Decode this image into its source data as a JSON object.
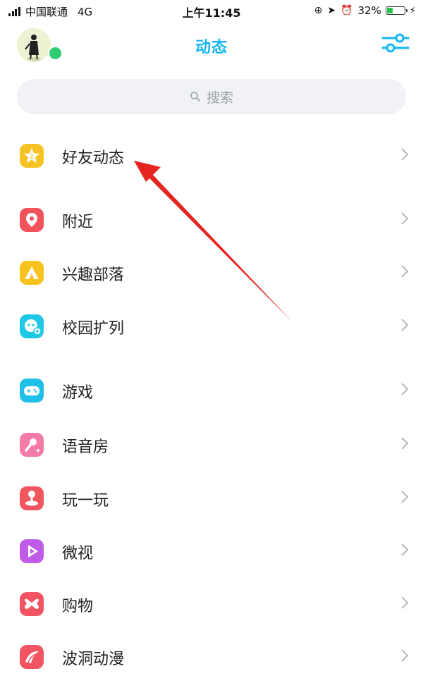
{
  "status_bar": {
    "carrier": "中国联通",
    "network": "4G",
    "time": "上午11:45",
    "battery_pct": "32%",
    "battery_level": 0.32
  },
  "header": {
    "title": "动态",
    "avatar_icon": "avatar-icon",
    "settings_icon": "sliders-icon"
  },
  "search": {
    "placeholder": "搜索"
  },
  "menu": [
    {
      "label": "好友动态",
      "icon": "star-icon",
      "color": "#f7c324"
    },
    {
      "label": "附近",
      "icon": "location-pin-icon",
      "color": "#f0535a"
    },
    {
      "label": "兴趣部落",
      "icon": "triangle-tribe-icon",
      "color": "#f6c21b"
    },
    {
      "label": "校园扩列",
      "icon": "campus-chat-icon",
      "color": "#1ec8e6"
    },
    {
      "label": "游戏",
      "icon": "gamepad-icon",
      "color": "#1ec0ea"
    },
    {
      "label": "语音房",
      "icon": "microphone-icon",
      "color": "#f47aa7"
    },
    {
      "label": "玩一玩",
      "icon": "joystick-icon",
      "color": "#f0565d"
    },
    {
      "label": "微视",
      "icon": "play-icon",
      "color": "#c05ae8"
    },
    {
      "label": "购物",
      "icon": "shopping-icon",
      "color": "#f25561"
    },
    {
      "label": "波洞动漫",
      "icon": "comic-icon",
      "color": "#f25561"
    }
  ],
  "colors": {
    "accent": "#12b7f5",
    "annotation_arrow": "#e42420",
    "online_dot": "#2ecc71"
  }
}
